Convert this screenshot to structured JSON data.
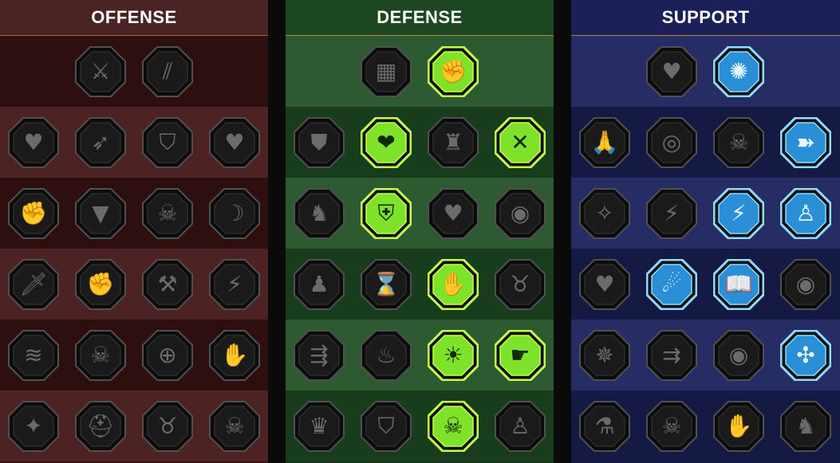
{
  "trees": [
    {
      "id": "offense",
      "title": "OFFENSE",
      "rows": [
        [
          {
            "icon": "crossed-swords-icon",
            "glyph": "⚔",
            "state": "locked"
          },
          {
            "icon": "claw-slash-icon",
            "glyph": "⫽",
            "state": "locked"
          }
        ],
        [
          {
            "icon": "demon-heart-icon",
            "glyph": "♥",
            "state": "locked"
          },
          {
            "icon": "swift-strike-icon",
            "glyph": "➶",
            "state": "locked"
          },
          {
            "icon": "shield-break-icon",
            "glyph": "⛉",
            "state": "locked"
          },
          {
            "icon": "bleeding-heart-icon",
            "glyph": "♥",
            "state": "locked"
          }
        ],
        [
          {
            "icon": "bound-fist-icon",
            "glyph": "✊",
            "state": "locked"
          },
          {
            "icon": "fanged-maw-icon",
            "glyph": "▼",
            "state": "locked"
          },
          {
            "icon": "skull-cloak-icon",
            "glyph": "☠",
            "state": "locked"
          },
          {
            "icon": "reaper-scythe-icon",
            "glyph": "☽",
            "state": "locked"
          }
        ],
        [
          {
            "icon": "sword-heart-icon",
            "glyph": "🗡",
            "state": "locked"
          },
          {
            "icon": "mace-fist-icon",
            "glyph": "✊",
            "state": "locked"
          },
          {
            "icon": "axe-icon",
            "glyph": "⚒",
            "state": "locked"
          },
          {
            "icon": "chain-lightning-icon",
            "glyph": "⚡",
            "state": "locked"
          }
        ],
        [
          {
            "icon": "claw-marks-icon",
            "glyph": "≋",
            "state": "locked"
          },
          {
            "icon": "skull-icon",
            "glyph": "☠",
            "state": "locked"
          },
          {
            "icon": "sword-circle-icon",
            "glyph": "⊕",
            "state": "locked"
          },
          {
            "icon": "brute-icon",
            "glyph": "✋",
            "state": "locked"
          }
        ],
        [
          {
            "icon": "sparkle-slash-icon",
            "glyph": "✦",
            "state": "locked"
          },
          {
            "icon": "knight-helm-icon",
            "glyph": "⛑",
            "state": "locked"
          },
          {
            "icon": "horned-demon-icon",
            "glyph": "♉",
            "state": "locked"
          },
          {
            "icon": "flaming-skull-icon",
            "glyph": "☠",
            "state": "locked"
          }
        ]
      ]
    },
    {
      "id": "defense",
      "title": "DEFENSE",
      "rows": [
        [
          {
            "icon": "brick-wall-icon",
            "glyph": "▦",
            "state": "locked"
          },
          {
            "icon": "raised-fist-icon",
            "glyph": "✊",
            "state": "active"
          }
        ],
        [
          {
            "icon": "chevron-shield-icon",
            "glyph": "⛊",
            "state": "locked"
          },
          {
            "icon": "heart-organ-icon",
            "glyph": "❤",
            "state": "active"
          },
          {
            "icon": "stone-golem-icon",
            "glyph": "♜",
            "state": "locked"
          },
          {
            "icon": "crossed-blades-icon",
            "glyph": "✕",
            "state": "active"
          }
        ],
        [
          {
            "icon": "warrior-pose-icon",
            "glyph": "♞",
            "state": "locked"
          },
          {
            "icon": "shield-knight-icon",
            "glyph": "⛨",
            "state": "active"
          },
          {
            "icon": "heart-shield-icon",
            "glyph": "♥",
            "state": "locked"
          },
          {
            "icon": "hooded-figure-icon",
            "glyph": "◉",
            "state": "locked"
          }
        ],
        [
          {
            "icon": "crowd-icon",
            "glyph": "♟",
            "state": "locked"
          },
          {
            "icon": "hourglass-icon",
            "glyph": "⌛",
            "state": "locked"
          },
          {
            "icon": "blood-hand-icon",
            "glyph": "✋",
            "state": "active"
          },
          {
            "icon": "bull-head-icon",
            "glyph": "♉",
            "state": "locked"
          }
        ],
        [
          {
            "icon": "dash-runner-icon",
            "glyph": "⇶",
            "state": "locked"
          },
          {
            "icon": "claw-flames-icon",
            "glyph": "♨",
            "state": "locked"
          },
          {
            "icon": "radiant-skull-icon",
            "glyph": "☀",
            "state": "active"
          },
          {
            "icon": "grasping-hand-icon",
            "glyph": "☛",
            "state": "active"
          }
        ],
        [
          {
            "icon": "armored-beast-icon",
            "glyph": "♛",
            "state": "locked"
          },
          {
            "icon": "winged-shield-icon",
            "glyph": "⛉",
            "state": "locked"
          },
          {
            "icon": "skull-lightning-icon",
            "glyph": "☠",
            "state": "active"
          },
          {
            "icon": "strongman-icon",
            "glyph": "♙",
            "state": "locked"
          }
        ]
      ]
    },
    {
      "id": "support",
      "title": "SUPPORT",
      "rows": [
        [
          {
            "icon": "heart-sparkle-icon",
            "glyph": "♥",
            "state": "locked"
          },
          {
            "icon": "energy-orb-icon",
            "glyph": "✺",
            "state": "active"
          }
        ],
        [
          {
            "icon": "praying-hands-icon",
            "glyph": "🙏",
            "state": "locked"
          },
          {
            "icon": "ripple-shield-icon",
            "glyph": "◎",
            "state": "locked"
          },
          {
            "icon": "skull-smoke-icon",
            "glyph": "☠",
            "state": "locked"
          },
          {
            "icon": "swift-feet-icon",
            "glyph": "➽",
            "state": "active"
          }
        ],
        [
          {
            "icon": "blessed-figure-icon",
            "glyph": "✧",
            "state": "locked"
          },
          {
            "icon": "lightning-bolt-icon",
            "glyph": "⚡",
            "state": "locked"
          },
          {
            "icon": "shattered-strike-icon",
            "glyph": "⚡",
            "state": "active"
          },
          {
            "icon": "twin-figures-icon",
            "glyph": "♙",
            "state": "active"
          }
        ],
        [
          {
            "icon": "chained-heart-icon",
            "glyph": "♥",
            "state": "locked"
          },
          {
            "icon": "fireball-icon",
            "glyph": "☄",
            "state": "active"
          },
          {
            "icon": "open-book-icon",
            "glyph": "📖",
            "state": "active"
          },
          {
            "icon": "glaring-eyes-icon",
            "glyph": "◉",
            "state": "locked"
          }
        ],
        [
          {
            "icon": "compass-star-icon",
            "glyph": "✵",
            "state": "locked"
          },
          {
            "icon": "speed-boot-icon",
            "glyph": "⇉",
            "state": "locked"
          },
          {
            "icon": "all-seeing-eye-icon",
            "glyph": "◉",
            "state": "locked"
          },
          {
            "icon": "voodoo-doll-icon",
            "glyph": "✣",
            "state": "active"
          }
        ],
        [
          {
            "icon": "potion-flask-icon",
            "glyph": "⚗",
            "state": "locked"
          },
          {
            "icon": "winged-skull-icon",
            "glyph": "☠",
            "state": "locked"
          },
          {
            "icon": "grasping-claws-icon",
            "glyph": "✋",
            "state": "locked"
          },
          {
            "icon": "eagle-head-icon",
            "glyph": "♞",
            "state": "locked"
          }
        ]
      ]
    }
  ],
  "colors": {
    "locked_fill": "#1a1a1a",
    "locked_ring": "#505050",
    "locked_glyph": "#6b6b6b",
    "defense_active_fill": "#7ee22a",
    "defense_active_ring": "#c6ff4a",
    "support_active_fill": "#2a8fd6",
    "support_active_ring": "#8fdcff"
  }
}
